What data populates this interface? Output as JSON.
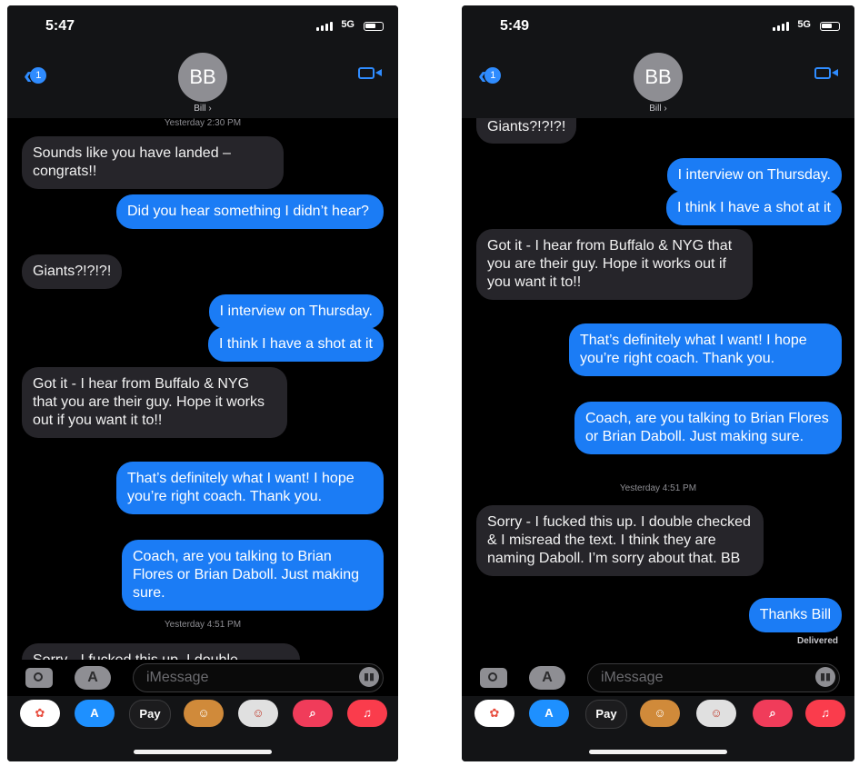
{
  "left": {
    "time": "5:47",
    "network": "5G",
    "back_badge": "1",
    "avatar_initials": "BB",
    "contact_name": "Bill ›",
    "timestamps": [
      "Yesterday 2:30 PM",
      "Yesterday 4:51 PM"
    ],
    "messages": [
      {
        "dir": "in",
        "text": "Sounds like you have landed – congrats!!"
      },
      {
        "dir": "out",
        "text": "Did you hear something I didn’t hear?"
      },
      {
        "dir": "in",
        "text": "Giants?!?!?!"
      },
      {
        "dir": "out",
        "text": "I interview on Thursday."
      },
      {
        "dir": "out",
        "text": "I think I have a shot at it"
      },
      {
        "dir": "in",
        "text": "Got it - I hear from Buffalo & NYG that you are their guy. Hope it works out if you want it to!!"
      },
      {
        "dir": "out",
        "text": "That’s definitely what I want! I hope you’re right coach. Thank you."
      },
      {
        "dir": "out",
        "text": "Coach, are you talking to Brian Flores or Brian Daboll. Just making sure."
      },
      {
        "dir": "in",
        "text": "Sorry - I fucked this up.  I double"
      }
    ],
    "input_placeholder": "iMessage"
  },
  "right": {
    "time": "5:49",
    "network": "5G",
    "back_badge": "1",
    "avatar_initials": "BB",
    "contact_name": "Bill ›",
    "timestamps": [
      "Yesterday 4:51 PM"
    ],
    "messages": [
      {
        "dir": "in",
        "text": "Giants?!?!?!"
      },
      {
        "dir": "out",
        "text": "I interview on Thursday."
      },
      {
        "dir": "out",
        "text": "I think I have a shot at it"
      },
      {
        "dir": "in",
        "text": "Got it - I hear from Buffalo & NYG that you are their guy. Hope it works out if you want it to!!"
      },
      {
        "dir": "out",
        "text": "That’s definitely what I want! I hope you’re right coach. Thank you."
      },
      {
        "dir": "out",
        "text": "Coach, are you talking to Brian Flores or Brian Daboll. Just making sure."
      },
      {
        "dir": "in",
        "text": "Sorry - I fucked this up.  I double checked & I misread the text. I think they are naming Daboll. I’m sorry about that. BB"
      },
      {
        "dir": "out",
        "text": "Thanks Bill"
      }
    ],
    "delivered": "Delivered",
    "input_placeholder": "iMessage"
  },
  "tray": {
    "app_labels": [
      "",
      "",
      "Pay",
      "",
      "",
      "",
      "♫"
    ],
    "app_icons": [
      "photos-icon",
      "app-store-icon",
      "apple-pay-icon",
      "memoji-icon",
      "memoji-stickers-icon",
      "image-search-icon",
      "music-icon"
    ],
    "colors": {
      "incoming": "#26252a",
      "outgoing": "#1b7cf5",
      "accent": "#2f8cff"
    }
  }
}
